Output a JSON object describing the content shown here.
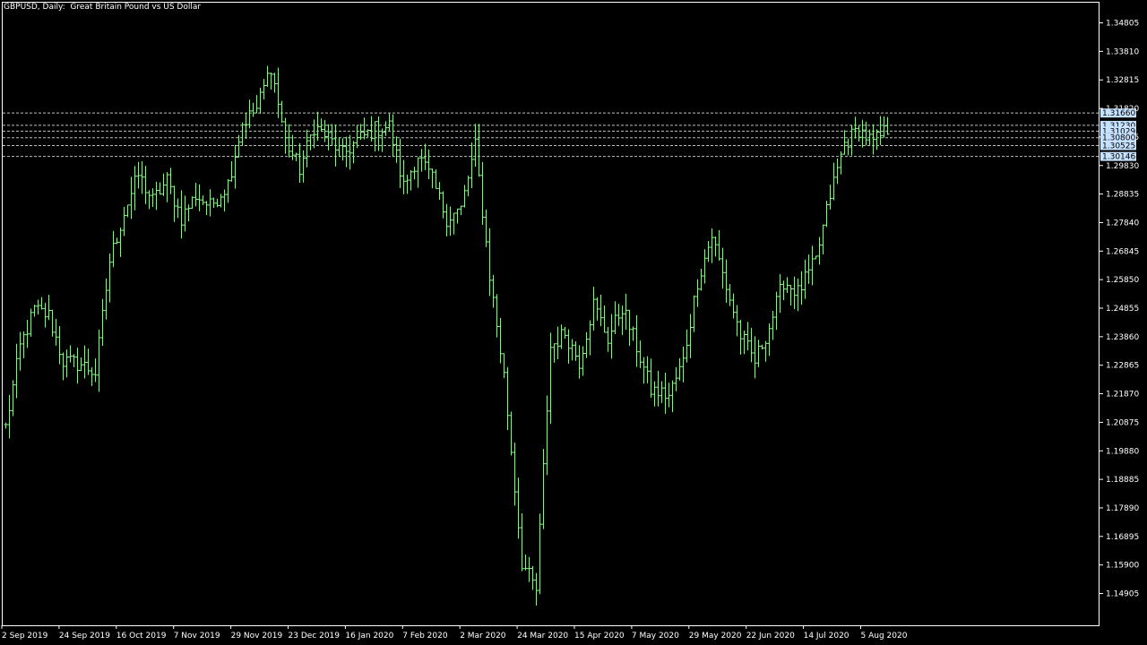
{
  "window": {
    "title": "GBPUSD, Daily:  Great Britain Pound vs US Dollar"
  },
  "colors": {
    "background": "#000000",
    "foreground": "#ffffff",
    "bar": "#90ee90",
    "grid_line": "#c0c0c0",
    "level_label_bg": "#c6e2ff"
  },
  "chart_data": {
    "type": "ohlc",
    "symbol": "GBPUSD",
    "timeframe": "Daily",
    "ylim": [
      1.1395,
      1.3535
    ],
    "price_ticks": [
      "1.34805",
      "1.33810",
      "1.32815",
      "1.31820",
      "1.30825",
      "1.29830",
      "1.28835",
      "1.27840",
      "1.26845",
      "1.25850",
      "1.24855",
      "1.23860",
      "1.22865",
      "1.21870",
      "1.20875",
      "1.19880",
      "1.18885",
      "1.17890",
      "1.16895",
      "1.15900",
      "1.14905"
    ],
    "date_ticks": [
      "2 Sep 2019",
      "24 Sep 2019",
      "16 Oct 2019",
      "7 Nov 2019",
      "29 Nov 2019",
      "23 Dec 2019",
      "16 Jan 2020",
      "7 Feb 2020",
      "2 Mar 2020",
      "24 Mar 2020",
      "15 Apr 2020",
      "7 May 2020",
      "29 May 2020",
      "22 Jun 2020",
      "14 Jul 2020",
      "5 Aug 2020"
    ],
    "horizontal_levels": [
      "1.31660",
      "1.31230",
      "1.31029",
      "1.30800",
      "1.30525",
      "1.30146"
    ],
    "close_path": [
      [
        "2 Sep 2019",
        1.207
      ],
      [
        "10 Sep 2019",
        1.235
      ],
      [
        "16 Sep 2019",
        1.248
      ],
      [
        "20 Sep 2019",
        1.246
      ],
      [
        "27 Sep 2019",
        1.23
      ],
      [
        "3 Oct 2019",
        1.229
      ],
      [
        "10 Oct 2019",
        1.226
      ],
      [
        "14 Oct 2019",
        1.265
      ],
      [
        "16 Oct 2019",
        1.282
      ],
      [
        "21 Oct 2019",
        1.295
      ],
      [
        "25 Oct 2019",
        1.286
      ],
      [
        "31 Oct 2019",
        1.293
      ],
      [
        "8 Nov 2019",
        1.28
      ],
      [
        "15 Nov 2019",
        1.288
      ],
      [
        "22 Nov 2019",
        1.284
      ],
      [
        "29 Nov 2019",
        1.292
      ],
      [
        "5 Dec 2019",
        1.313
      ],
      [
        "11 Dec 2019",
        1.318
      ],
      [
        "13 Dec 2019",
        1.333
      ],
      [
        "17 Dec 2019",
        1.307
      ],
      [
        "23 Dec 2019",
        1.297
      ],
      [
        "27 Dec 2019",
        1.312
      ],
      [
        "3 Jan 2020",
        1.308
      ],
      [
        "10 Jan 2020",
        1.302
      ],
      [
        "16 Jan 2020",
        1.307
      ],
      [
        "24 Jan 2020",
        1.311
      ],
      [
        "31 Jan 2020",
        1.312
      ],
      [
        "7 Feb 2020",
        1.291
      ],
      [
        "14 Feb 2020",
        1.302
      ],
      [
        "21 Feb 2020",
        1.293
      ],
      [
        "28 Feb 2020",
        1.28
      ],
      [
        "2 Mar 2020",
        1.283
      ],
      [
        "9 Mar 2020",
        1.305
      ],
      [
        "12 Mar 2020",
        1.26
      ],
      [
        "16 Mar 2020",
        1.225
      ],
      [
        "20 Mar 2020",
        1.16
      ],
      [
        "24 Mar 2020",
        1.15
      ],
      [
        "27 Mar 2020",
        1.235
      ],
      [
        "31 Mar 2020",
        1.24
      ],
      [
        "7 Apr 2020",
        1.23
      ],
      [
        "15 Apr 2020",
        1.25
      ],
      [
        "21 Apr 2020",
        1.238
      ],
      [
        "30 Apr 2020",
        1.249
      ],
      [
        "7 May 2020",
        1.235
      ],
      [
        "14 May 2020",
        1.22
      ],
      [
        "21 May 2020",
        1.218
      ],
      [
        "29 May 2020",
        1.23
      ],
      [
        "4 Jun 2020",
        1.258
      ],
      [
        "10 Jun 2020",
        1.274
      ],
      [
        "16 Jun 2020",
        1.256
      ],
      [
        "22 Jun 2020",
        1.239
      ],
      [
        "26 Jun 2020",
        1.23
      ],
      [
        "3 Jul 2020",
        1.242
      ],
      [
        "9 Jul 2020",
        1.258
      ],
      [
        "14 Jul 2020",
        1.254
      ],
      [
        "20 Jul 2020",
        1.265
      ],
      [
        "27 Jul 2020",
        1.288
      ],
      [
        "31 Jul 2020",
        1.306
      ],
      [
        "5 Aug 2020",
        1.311
      ],
      [
        "10 Aug 2020",
        1.306
      ],
      [
        "14 Aug 2020",
        1.311
      ]
    ]
  }
}
